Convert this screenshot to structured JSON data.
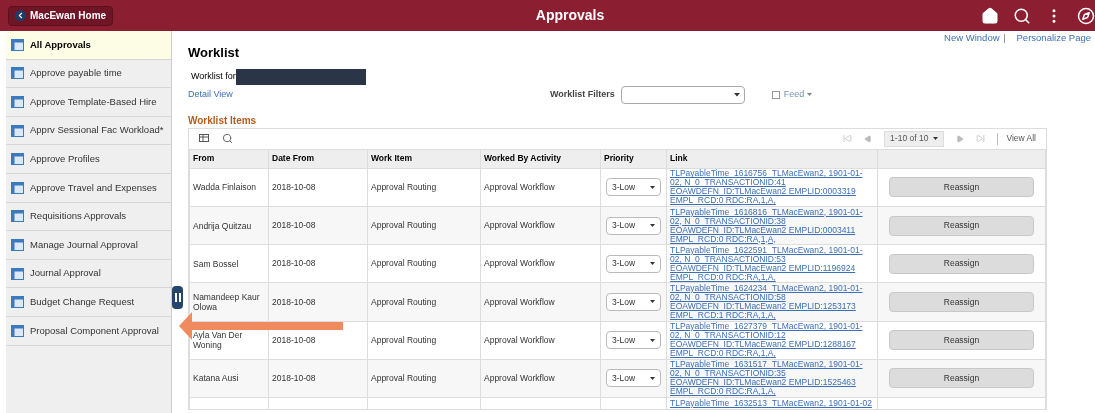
{
  "header": {
    "home_button": "MacEwan Home",
    "title": "Approvals"
  },
  "sidebar": {
    "items": [
      {
        "label": "All Approvals",
        "selected": true
      },
      {
        "label": "Approve payable time",
        "selected": false
      },
      {
        "label": "Approve Template-Based Hire",
        "selected": false
      },
      {
        "label": "Apprv Sessional Fac Workload*",
        "selected": false
      },
      {
        "label": "Approve Profiles",
        "selected": false
      },
      {
        "label": "Approve Travel and Expenses",
        "selected": false
      },
      {
        "label": "Requisitions Approvals",
        "selected": false
      },
      {
        "label": "Manage Journal Approval",
        "selected": false
      },
      {
        "label": "Journal Approval",
        "selected": false
      },
      {
        "label": "Budget Change Request",
        "selected": false
      },
      {
        "label": "Proposal Component Approval",
        "selected": false
      }
    ]
  },
  "top_links": [
    "New Window",
    "Personalize Page"
  ],
  "page_title": "Worklist",
  "worklist_for": "Worklist for",
  "detail_view": "Detail View",
  "filters": {
    "label": "Worklist Filters"
  },
  "feed": {
    "label": "Feed",
    "checked": false
  },
  "section_title": "Worklist Items",
  "pagination": {
    "range": "1-10 of 10",
    "view_all": "View All"
  },
  "table": {
    "columns": [
      "From",
      "Date From",
      "Work Item",
      "Worked By Activity",
      "Priority",
      "Link"
    ],
    "rows": [
      {
        "from": "Wadda Finlaison",
        "date": "2018-10-08",
        "item": "Approval Routing",
        "activity": "Approval Workflow",
        "priority": "3-Low",
        "link": "TLPayableTime_1616756_TLMacEwan2, 1901-01-02, N_0_TRANSACTIONID:41 EOAWDEFN_ID:TLMacEwan2 EMPLID:0003319 EMPL_RCD:0 RDC:RA,1,A,",
        "action": "Reassign"
      },
      {
        "from": "Andrija Quitzau",
        "date": "2018-10-08",
        "item": "Approval Routing",
        "activity": "Approval Workflow",
        "priority": "3-Low",
        "link": "TLPayableTime_1616816_TLMacEwan2, 1901-01-02, N_0_TRANSACTIONID:38 EOAWDEFN_ID:TLMacEwan2 EMPLID:0003411 EMPL_RCD:0 RDC:RA,1,A,",
        "action": "Reassign"
      },
      {
        "from": "Sam Bossel",
        "date": "2018-10-08",
        "item": "Approval Routing",
        "activity": "Approval Workflow",
        "priority": "3-Low",
        "link": "TLPayableTime_1622591_TLMacEwan2, 1901-01-02, N_0_TRANSACTIONID:53 EOAWDEFN_ID:TLMacEwan2 EMPLID:1196924 EMPL_RCD:0 RDC:RA,1,A,",
        "action": "Reassign"
      },
      {
        "from": "Namandeep Kaur Olowa",
        "date": "2018-10-08",
        "item": "Approval Routing",
        "activity": "Approval Workflow",
        "priority": "3-Low",
        "link": "TLPayableTime_1624234_TLMacEwan2, 1901-01-02, N_0_TRANSACTIONID:58 EOAWDEFN_ID:TLMacEwan2 EMPLID:1253173 EMPL_RCD:1 RDC:RA,1,A,",
        "action": "Reassign"
      },
      {
        "from": "Ayla Van Der Woning",
        "date": "2018-10-08",
        "item": "Approval Routing",
        "activity": "Approval Workflow",
        "priority": "3-Low",
        "link": "TLPayableTime_1627379_TLMacEwan2, 1901-01-02, N_0_TRANSACTIONID:12 EOAWDEFN_ID:TLMacEwan2 EMPLID:1288167 EMPL_RCD:0 RDC:RA,1,A,",
        "action": "Reassign"
      },
      {
        "from": "Katana Ausi",
        "date": "2018-10-08",
        "item": "Approval Routing",
        "activity": "Approval Workflow",
        "priority": "3-Low",
        "link": "TLPayableTime_1631517_TLMacEwan2, 1901-01-02, N_0_TRANSACTIONID:35 EOAWDEFN_ID:TLMacEwan2 EMPLID:1525463 EMPL_RCD:0 RDC:RA,1,A,",
        "action": "Reassign"
      },
      {
        "link": "TLPayableTime_1632513_TLMacEwan2, 1901-01-02"
      }
    ]
  }
}
